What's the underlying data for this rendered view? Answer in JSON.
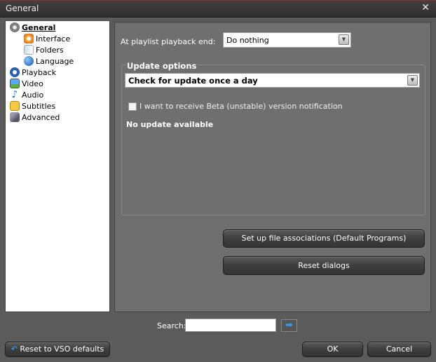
{
  "window": {
    "title": "General",
    "close": "✕"
  },
  "tree": [
    {
      "label": "General",
      "icon": "gear-icon"
    },
    {
      "label": "Interface",
      "icon": "interface-icon"
    },
    {
      "label": "Folders",
      "icon": "folder-icon"
    },
    {
      "label": "Language",
      "icon": "globe-icon"
    },
    {
      "label": "Playback",
      "icon": "play-icon"
    },
    {
      "label": "Video",
      "icon": "video-icon"
    },
    {
      "label": "Audio",
      "icon": "music-note-icon"
    },
    {
      "label": "Subtitles",
      "icon": "subtitles-icon"
    },
    {
      "label": "Advanced",
      "icon": "wrench-icon"
    }
  ],
  "general": {
    "playlist_end_label": "At playlist playback end:",
    "playlist_end_value": "Do nothing",
    "update_group_label": "Update options",
    "update_value": "Check for update once a day",
    "beta_label": "I want to receive Beta (unstable) version notification",
    "beta_checked": false,
    "update_status": "No update available",
    "file_assoc_button": "Set up file associations (Default Programs)",
    "reset_dialogs_button": "Reset dialogs"
  },
  "search": {
    "label": "Search:",
    "value": ""
  },
  "footer": {
    "reset_defaults": "Reset to VSO defaults",
    "ok": "OK",
    "cancel": "Cancel"
  }
}
